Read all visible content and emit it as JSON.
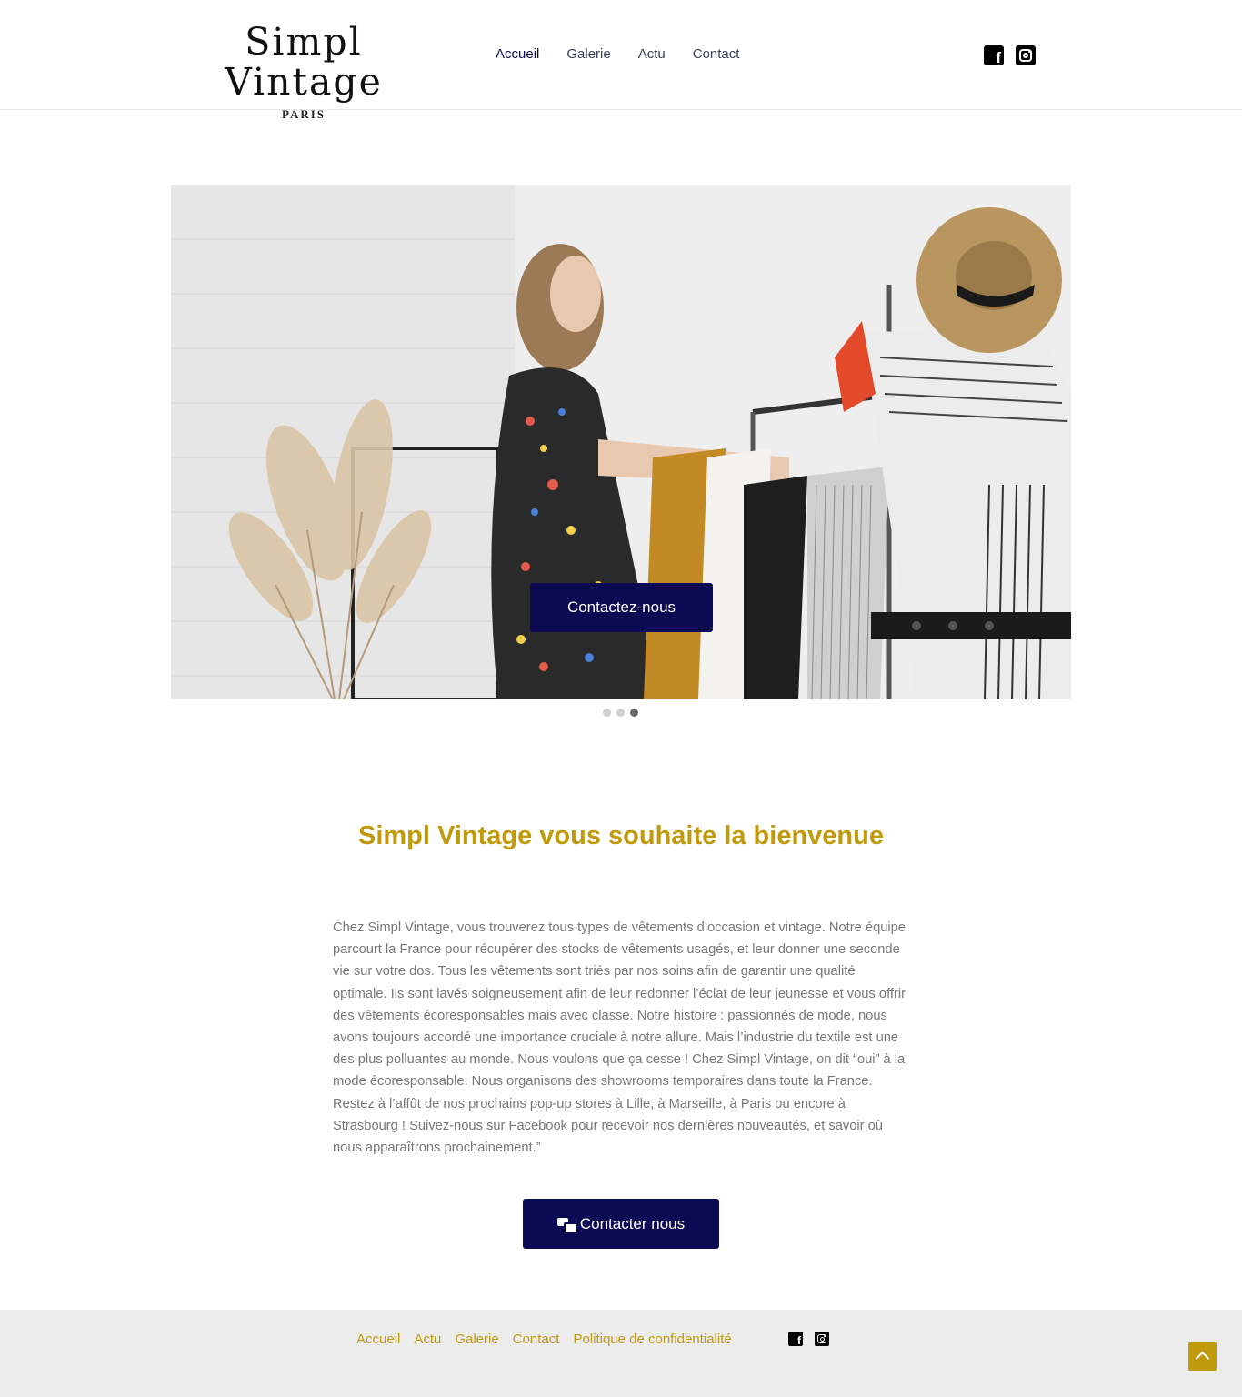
{
  "brand": {
    "name": "Simpl Vintage",
    "location": "PARIS"
  },
  "nav": {
    "items": [
      {
        "label": "Accueil",
        "active": true
      },
      {
        "label": "Galerie",
        "active": false
      },
      {
        "label": "Actu",
        "active": false
      },
      {
        "label": "Contact",
        "active": false
      }
    ]
  },
  "social": {
    "icons": [
      "facebook-icon",
      "instagram-icon"
    ]
  },
  "hero": {
    "button_label": "Contactez-nous",
    "slides_total": 3,
    "active_slide": 3
  },
  "welcome": {
    "title": "Simpl Vintage vous souhaite la bienvenue",
    "body": "Chez Simpl Vintage, vous trouverez tous types de vêtements d’occasion et vintage. Notre équipe parcourt la France pour récupérer des stocks de vêtements usagés, et leur donner une seconde vie sur votre dos. Tous les vêtements sont triés par nos soins afin de garantir une qualité optimale. Ils sont lavés soigneusement afin de leur redonner l’éclat de leur jeunesse et vous offrir des vêtements écoresponsables mais avec classe. Notre histoire : passionnés de mode, nous avons toujours accordé une importance cruciale à notre allure. Mais l’industrie du textile est une des plus polluantes au monde. Nous voulons que ça cesse ! Chez Simpl Vintage, on dit “oui” à la mode écoresponsable. Nous organisons des showrooms temporaires dans toute la France. Restez à l’affût de nos prochains pop-up stores à Lille, à Marseille, à Paris ou encore à Strasbourg ! Suivez-nous sur Facebook pour recevoir nos dernières nouveautés, et savoir où nous apparaîtrons prochainement.”",
    "cta_label": "Contacter nous",
    "cta_icon": "mail-bulk-icon"
  },
  "footer": {
    "links": [
      "Accueil",
      "Actu",
      "Galerie",
      "Contact",
      "Politique de confidentialité"
    ],
    "scroll_top_icon": "chevron-up-icon"
  },
  "colors": {
    "primary": "#0b0a52",
    "accent": "#c19a0c",
    "text_muted": "#777777",
    "footer_bg": "#ececec"
  }
}
